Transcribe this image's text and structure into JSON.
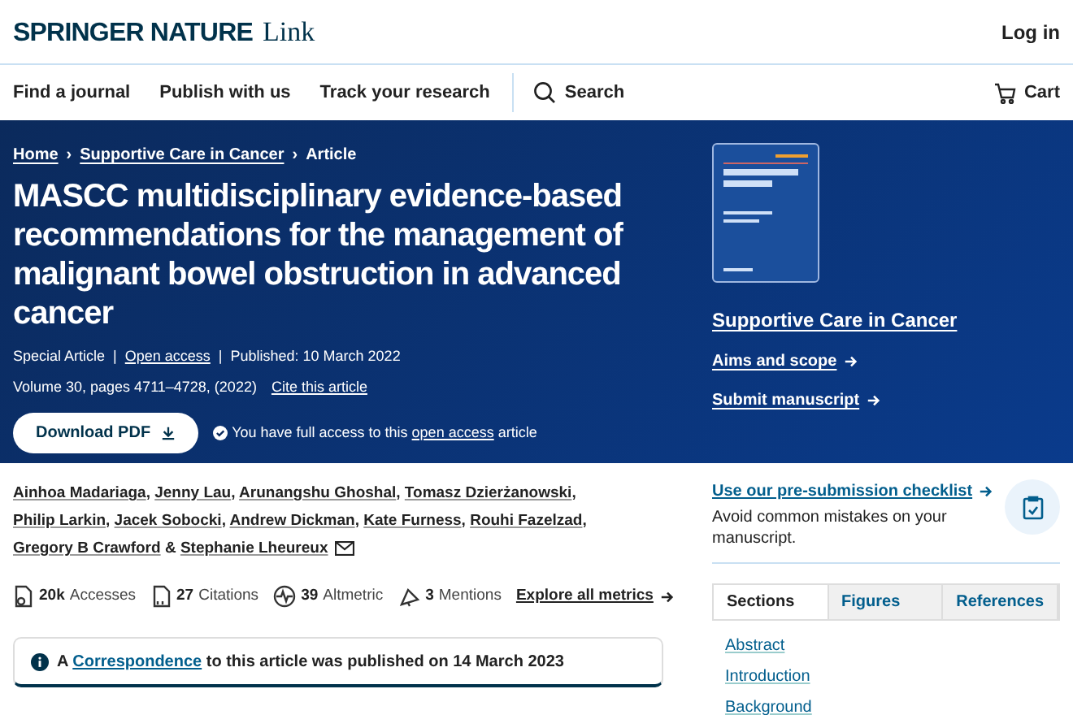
{
  "header": {
    "logo": "SPRINGER NATURE",
    "logo_suffix": "Link",
    "login": "Log in"
  },
  "nav": {
    "items": [
      "Find a journal",
      "Publish with us",
      "Track your research"
    ],
    "search": "Search",
    "cart": "Cart"
  },
  "breadcrumbs": [
    "Home",
    "Supportive Care in Cancer",
    "Article"
  ],
  "breadcrumb_separator": "›",
  "meta_separator": "|",
  "article": {
    "title": "MASCC multidisciplinary evidence-based recommendations for the management of malignant bowel obstruction in advanced cancer",
    "type": "Special Article",
    "access": "Open access",
    "published": "Published: 10 March 2022",
    "volume": "Volume 30, pages 4711–4728, (2022)",
    "cite": "Cite this article",
    "download": "Download PDF",
    "access_note": "You have full access to this",
    "access_link": "open access",
    "access_end": "article"
  },
  "journal": {
    "name": "Supportive Care in Cancer",
    "links": [
      "Aims and scope",
      "Submit manuscript"
    ]
  },
  "authors": {
    "names": [
      "Ainhoa Madariaga",
      "Jenny Lau",
      "Arunangshu Ghoshal",
      "Tomasz Dzierżanowski",
      "Philip Larkin",
      "Jacek Sobocki",
      "Andrew Dickman",
      "Kate Furness",
      "Rouhi Fazelzad",
      "Gregory B Crawford",
      "Stephanie Lheureux"
    ],
    "separator": ",",
    "ampersand": "&"
  },
  "metrics": [
    {
      "kind": "accesses",
      "count": "20k",
      "label": "Accesses"
    },
    {
      "kind": "citations",
      "count": "27",
      "label": "Citations"
    },
    {
      "kind": "altmetric",
      "count": "39",
      "label": "Altmetric"
    },
    {
      "kind": "mentions",
      "count": "3",
      "label": "Mentions"
    }
  ],
  "explore_metrics": "Explore all metrics",
  "notice": {
    "before": "A",
    "link": "Correspondence",
    "after": "to this article was published on 14 March 2023"
  },
  "checklist": {
    "link": "Use our pre-submission checklist",
    "text": "Avoid common mistakes on your manuscript."
  },
  "tabs": [
    {
      "label": "Sections",
      "selected": true
    },
    {
      "label": "Figures",
      "selected": false
    },
    {
      "label": "References",
      "selected": false
    }
  ],
  "sections": [
    "Abstract",
    "Introduction",
    "Background"
  ]
}
